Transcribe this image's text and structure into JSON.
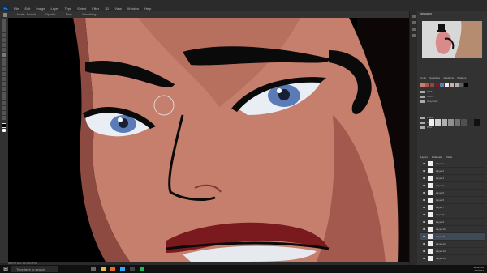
{
  "app": {
    "logo": "Ps",
    "menu": [
      "File",
      "Edit",
      "Image",
      "Layer",
      "Type",
      "Select",
      "Filter",
      "3D",
      "View",
      "Window",
      "Help"
    ],
    "doc_tabs": [
      "hourglass-portrait-final.psd @ 66.7%",
      "EMI_part2-C.psd @ 33.3% (Layer 1, RGB/8#) *"
    ],
    "options": [
      "Mode:",
      "Normal",
      "Opacity:",
      "Flow:",
      "Smoothing:"
    ],
    "status_text": "66.67%   Doc: 86.2M/1.57G"
  },
  "panels": {
    "navigator_tab": "Navigator",
    "swatch_tabs": [
      "Color",
      "Swatches",
      "Gradients",
      "Patterns"
    ],
    "swatch_folders": [
      "RGB",
      "CMYK",
      "Grayscale",
      "Pastel",
      "Light",
      "Pure"
    ],
    "layers_tabs": [
      "Layers",
      "Channels",
      "Paths"
    ],
    "layers": [
      "Layer 1",
      "Layer 2",
      "Layer 3",
      "Layer 4",
      "Layer 5",
      "Layer 6",
      "Layer 7",
      "Layer 8",
      "Layer 9",
      "Layer 10",
      "Layer 11",
      "Layer 12",
      "Layer 13",
      "Layer 14"
    ]
  },
  "colors": {
    "background_canvas": "#000000",
    "skin": "#c57f6c",
    "skin_shadow": "#a4594f",
    "iris": "#5b7bb7",
    "lips": "#7a1a1e"
  },
  "taskbar": {
    "search_placeholder": "Type here to search",
    "time": "11:52 PM",
    "date": "4/9/2022"
  }
}
